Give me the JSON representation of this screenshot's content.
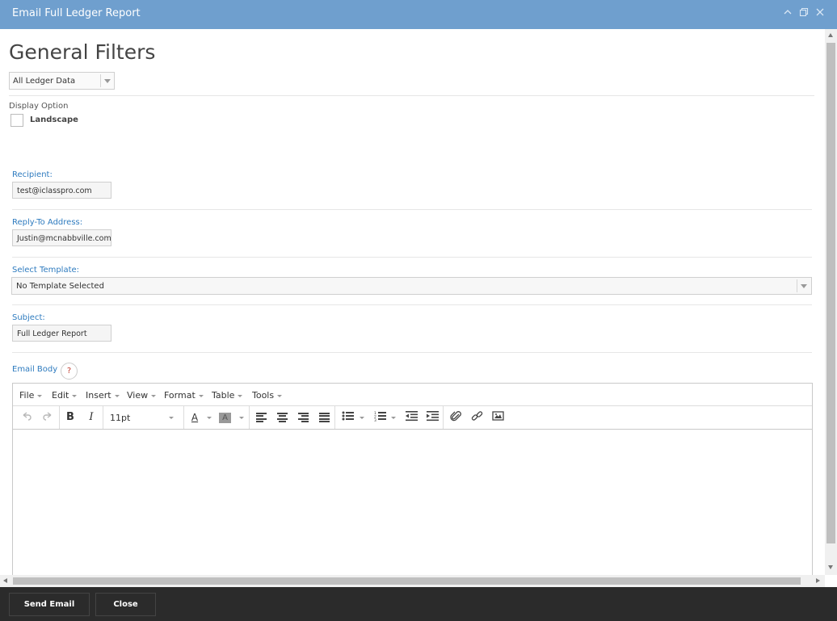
{
  "window": {
    "title": "Email Full Ledger Report"
  },
  "filters": {
    "heading": "General Filters",
    "ledger_select": "All Ledger Data",
    "display_option_label": "Display Option",
    "landscape_label": "Landscape",
    "landscape_checked": false
  },
  "email": {
    "recipient_label": "Recipient:",
    "recipient_value": "test@iclasspro.com",
    "reply_to_label": "Reply-To Address:",
    "reply_to_value": "Justin@mcnabbville.com",
    "template_label": "Select Template:",
    "template_value": "No Template Selected",
    "subject_label": "Subject:",
    "subject_value": "Full Ledger Report",
    "body_label": "Email Body",
    "help_glyph": "?"
  },
  "editor": {
    "menus": [
      "File",
      "Edit",
      "Insert",
      "View",
      "Format",
      "Table",
      "Tools"
    ],
    "font_size": "11pt"
  },
  "footer": {
    "send_label": "Send Email",
    "close_label": "Close"
  },
  "colors": {
    "titlebar": "#6f9fce",
    "label_blue": "#2e7bbf",
    "footer": "#2b2b2b"
  }
}
